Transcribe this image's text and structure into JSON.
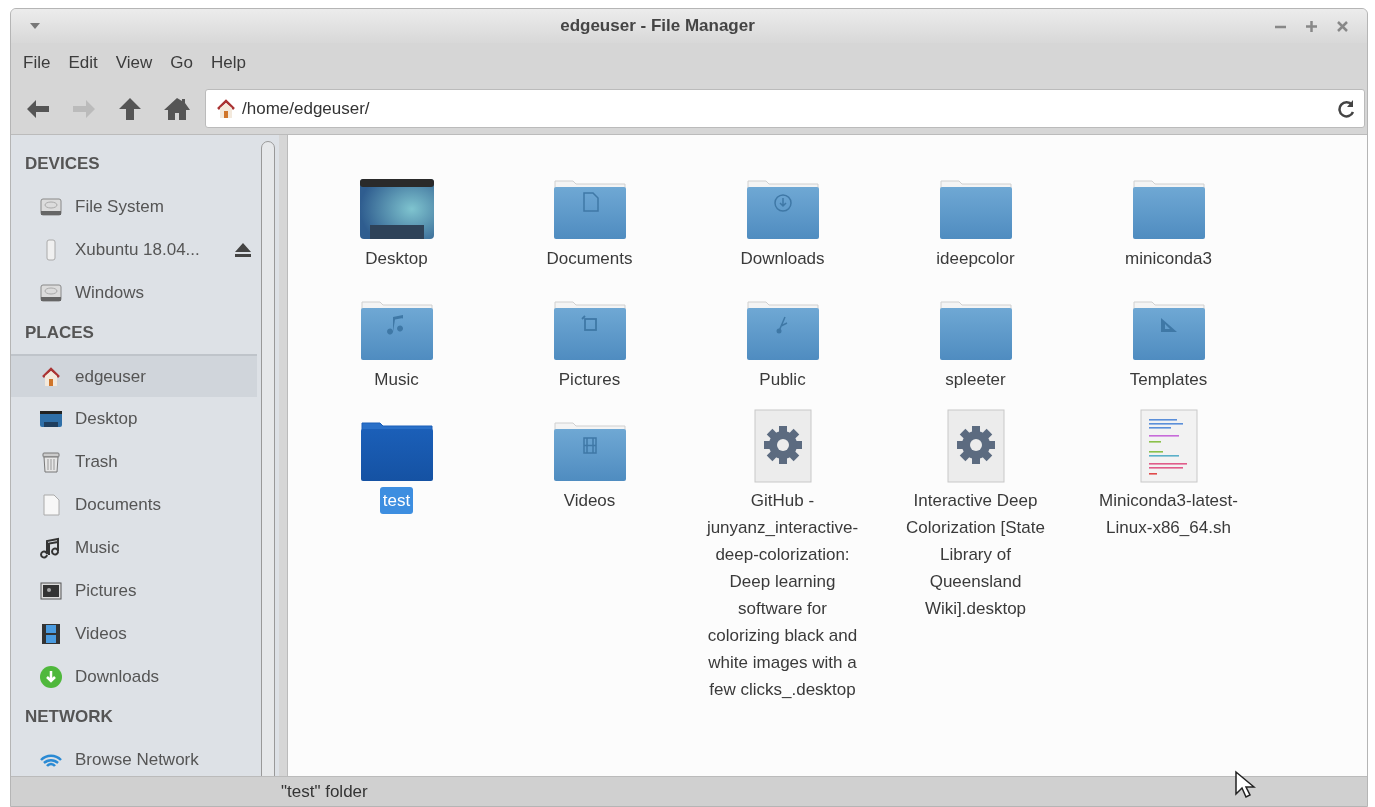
{
  "window": {
    "title": "edgeuser - File Manager"
  },
  "menu": [
    "File",
    "Edit",
    "View",
    "Go",
    "Help"
  ],
  "toolbar": {
    "back_disabled": false,
    "forward_disabled": true,
    "address": "/home/edgeuser/"
  },
  "sidebar": {
    "sections": [
      {
        "title": "DEVICES",
        "items": [
          {
            "label": "File System",
            "kind": "drive",
            "selected": false
          },
          {
            "label": "Xubuntu 18.04...",
            "kind": "usb",
            "selected": false
          },
          {
            "label": "Windows",
            "kind": "drive",
            "selected": false
          }
        ]
      },
      {
        "title": "PLACES",
        "items": [
          {
            "label": "edgeuser",
            "kind": "home",
            "selected": true
          },
          {
            "label": "Desktop",
            "kind": "desktop",
            "selected": false
          },
          {
            "label": "Trash",
            "kind": "trash",
            "selected": false
          },
          {
            "label": "Documents",
            "kind": "document",
            "selected": false
          },
          {
            "label": "Music",
            "kind": "music",
            "selected": false
          },
          {
            "label": "Pictures",
            "kind": "pictures",
            "selected": false
          },
          {
            "label": "Videos",
            "kind": "videos",
            "selected": false
          },
          {
            "label": "Downloads",
            "kind": "downloads",
            "selected": false
          }
        ]
      },
      {
        "title": "NETWORK",
        "items": [
          {
            "label": "Browse Network",
            "kind": "network",
            "selected": false
          }
        ]
      }
    ]
  },
  "files": [
    {
      "label": "Desktop",
      "kind": "desktop",
      "selected": false
    },
    {
      "label": "Documents",
      "kind": "documents",
      "selected": false
    },
    {
      "label": "Downloads",
      "kind": "downloads",
      "selected": false
    },
    {
      "label": "ideepcolor",
      "kind": "folder",
      "selected": false
    },
    {
      "label": "miniconda3",
      "kind": "folder",
      "selected": false
    },
    {
      "label": "Music",
      "kind": "music",
      "selected": false
    },
    {
      "label": "Pictures",
      "kind": "pictures",
      "selected": false
    },
    {
      "label": "Public",
      "kind": "public",
      "selected": false
    },
    {
      "label": "spleeter",
      "kind": "folder",
      "selected": false
    },
    {
      "label": "Templates",
      "kind": "templates",
      "selected": false
    },
    {
      "label": "test",
      "kind": "folder",
      "selected": true
    },
    {
      "label": "Videos",
      "kind": "videos",
      "selected": false
    },
    {
      "label": "GitHub - junyanz_interactive-deep-colorization: Deep learning software for colorizing black and white images with a few clicks_.desktop",
      "kind": "launcher",
      "selected": false
    },
    {
      "label": "Interactive Deep Colorization [State Library of Queensland Wiki].desktop",
      "kind": "launcher",
      "selected": false
    },
    {
      "label": "Miniconda3-latest-Linux-x86_64.sh",
      "kind": "script",
      "selected": false
    }
  ],
  "status_bar": "\"test\" folder"
}
